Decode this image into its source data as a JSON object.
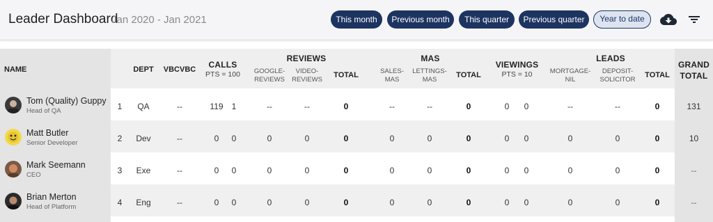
{
  "header": {
    "title": "Leader Dashboard",
    "date_range": "Jan 2020 - Jan 2021",
    "filters": [
      "This month",
      "Previous month",
      "This quarter",
      "Previous quarter",
      "Year to date"
    ],
    "active_filter": "Year to date",
    "download_icon": "cloud-download-icon",
    "filter_icon": "filter-icon"
  },
  "columns": {
    "name": "NAME",
    "dept": "DEPT",
    "vbc": "VBCVBC",
    "calls": "CALLS",
    "calls_pts": "PTS = 100",
    "reviews": "REVIEWS",
    "google_reviews": [
      "GOOGLE-",
      "REVIEWS"
    ],
    "video_reviews": [
      "VIDEO-",
      "REVIEWS"
    ],
    "reviews_total": "TOTAL",
    "mas": "MAS",
    "sales_mas": [
      "SALES-",
      "MAS"
    ],
    "lettings_mas": [
      "LETTINGS-",
      "MAS"
    ],
    "mas_total": "TOTAL",
    "viewings": "VIEWINGS",
    "viewings_pts": "PTS = 10",
    "leads": "LEADS",
    "mortgage_nil": [
      "MORTGAGE-",
      "NIL"
    ],
    "deposit_solicitor": [
      "DEPOSIT-",
      "SOLICITOR"
    ],
    "leads_total": "TOTAL",
    "grand_total": [
      "GRAND",
      "TOTAL"
    ]
  },
  "rows": [
    {
      "name": "Tom (Quality) Guppy",
      "role": "Head of QA",
      "rank": "1",
      "dept": "QA",
      "vbc": "--",
      "calls_a": "119",
      "calls_b": "1",
      "google": "--",
      "video": "--",
      "reviews_total": "0",
      "sales_mas": "--",
      "lettings_mas": "--",
      "mas_total": "0",
      "view_a": "0",
      "view_b": "0",
      "mortgage": "--",
      "deposit": "--",
      "leads_total": "0",
      "grand": "131"
    },
    {
      "name": "Matt Butler",
      "role": "Senior Developer",
      "rank": "2",
      "dept": "Dev",
      "vbc": "--",
      "calls_a": "0",
      "calls_b": "0",
      "google": "0",
      "video": "0",
      "reviews_total": "0",
      "sales_mas": "0",
      "lettings_mas": "0",
      "mas_total": "0",
      "view_a": "0",
      "view_b": "0",
      "mortgage": "0",
      "deposit": "0",
      "leads_total": "0",
      "grand": "10"
    },
    {
      "name": "Mark Seemann",
      "role": "CEO",
      "rank": "3",
      "dept": "Exe",
      "vbc": "--",
      "calls_a": "0",
      "calls_b": "0",
      "google": "0",
      "video": "0",
      "reviews_total": "0",
      "sales_mas": "0",
      "lettings_mas": "0",
      "mas_total": "0",
      "view_a": "0",
      "view_b": "0",
      "mortgage": "0",
      "deposit": "0",
      "leads_total": "0",
      "grand": "--"
    },
    {
      "name": "Brian Merton",
      "role": "Head of Platform",
      "rank": "4",
      "dept": "Eng",
      "vbc": "--",
      "calls_a": "0",
      "calls_b": "0",
      "google": "0",
      "video": "0",
      "reviews_total": "0",
      "sales_mas": "0",
      "lettings_mas": "0",
      "mas_total": "0",
      "view_a": "0",
      "view_b": "0",
      "mortgage": "0",
      "deposit": "0",
      "leads_total": "0",
      "grand": "--"
    }
  ]
}
